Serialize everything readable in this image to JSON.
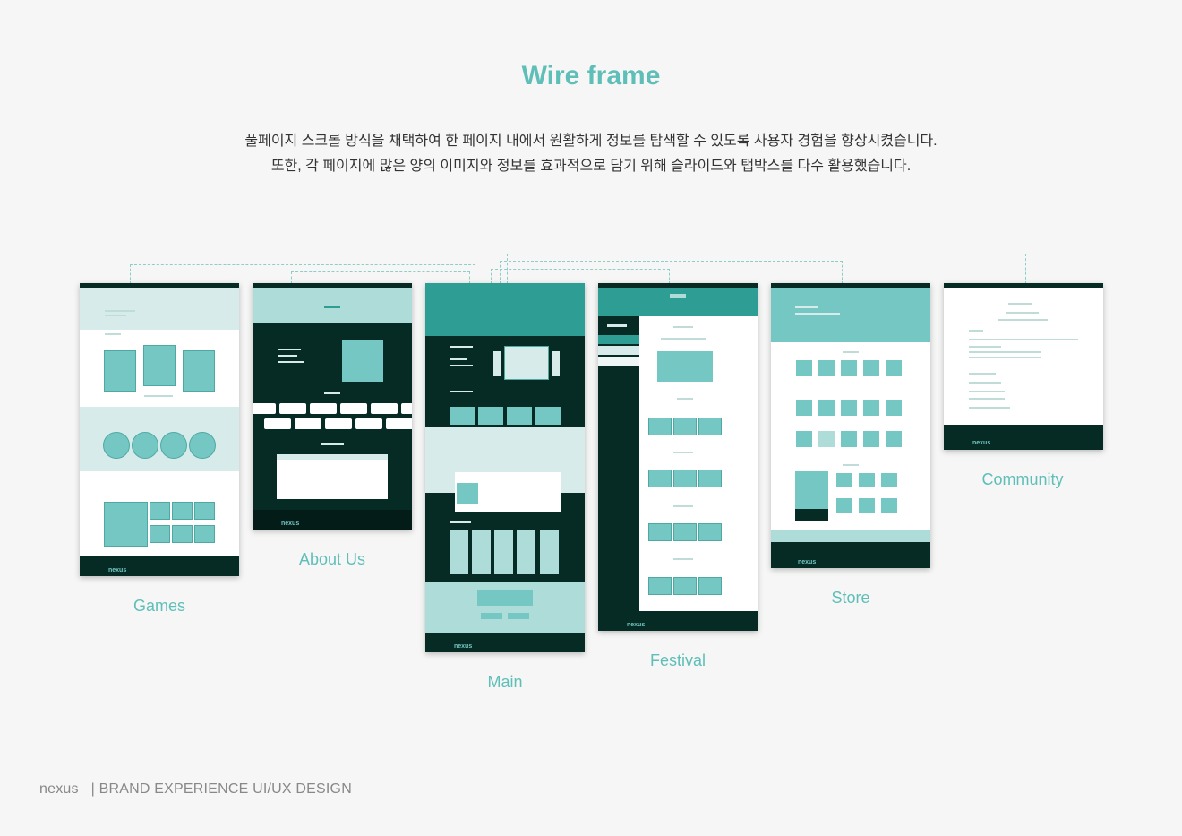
{
  "page": {
    "title": "Wire frame",
    "description": [
      "풀페이지 스크롤 방식을 채택하여 한 페이지 내에서 원활하게 정보를 탐색할 수 있도록 사용자 경험을 향상시켰습니다.",
      "또한, 각 페이지에 많은 양의 이미지와 정보를 효과적으로 담기 위해 슬라이드와 탭박스를 다수 활용했습니다."
    ]
  },
  "frames": [
    {
      "name": "Games"
    },
    {
      "name": "About Us"
    },
    {
      "name": "Main"
    },
    {
      "name": "Festival"
    },
    {
      "name": "Store"
    },
    {
      "name": "Community"
    }
  ],
  "footer": {
    "brand": "nexus",
    "separator": "|",
    "tagline": "BRAND EXPERIENCE UI/UX DESIGN"
  },
  "thumbnail": {
    "logo_text": "nexus"
  },
  "colors": {
    "accent": "#5fbfb8",
    "teal": "#74c7c2",
    "mint": "#d7ecea",
    "dark": "#062a24",
    "background": "#f5f6f5"
  }
}
